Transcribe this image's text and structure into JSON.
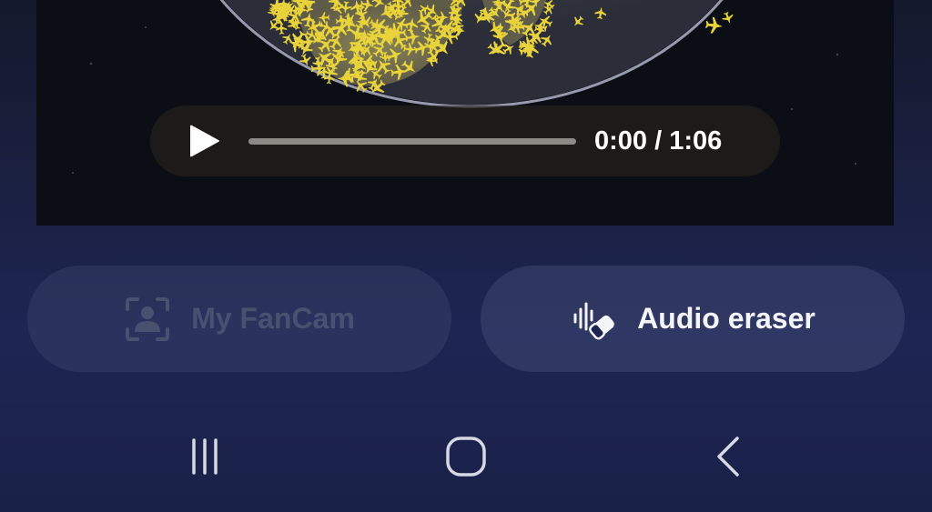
{
  "player": {
    "current_time": "0:00",
    "duration": "1:06",
    "time_display": "0:00 / 1:06",
    "progress": 0.0,
    "play_icon": "play-icon"
  },
  "actions": {
    "fancam": {
      "label": "My FanCam",
      "icon": "person-frame-icon",
      "enabled": false
    },
    "audio_eraser": {
      "label": "Audio eraser",
      "icon": "audio-eraser-icon",
      "enabled": true
    }
  },
  "navigation": {
    "recents_icon": "recents-icon",
    "home_icon": "home-icon",
    "back_icon": "back-icon"
  },
  "colors": {
    "background_top": "#14192c",
    "background_bottom": "#1e2553",
    "disabled_text": "#4a5170",
    "active_text": "#f4f5f8",
    "plane_yellow": "#e8d33a"
  }
}
